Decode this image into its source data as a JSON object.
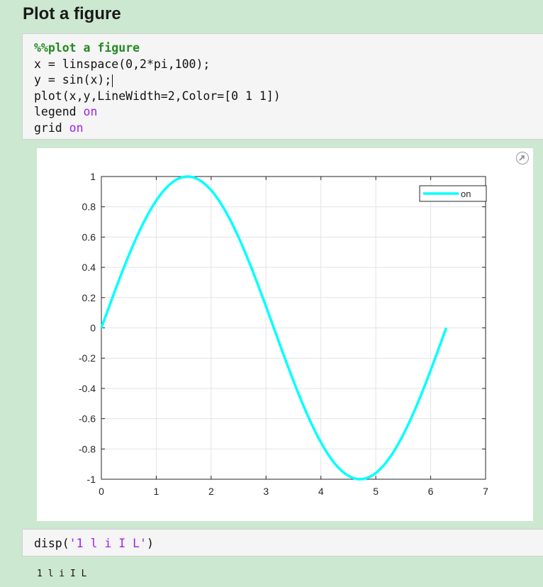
{
  "section": {
    "title": "Plot a figure"
  },
  "code_cell_1": {
    "comment_line": "%%plot a figure",
    "line_linspace": "x = linspace(0,2*pi,100);",
    "line_sin": "y = sin(x);",
    "line_plot": "plot(x,y,LineWidth=2,Color=[0 1 1])",
    "legend_cmd": "legend ",
    "legend_arg": "on",
    "grid_cmd": "grid ",
    "grid_arg": "on"
  },
  "figure": {
    "expand_icon": "expand-arrow-icon"
  },
  "chart_data": {
    "type": "line",
    "function": "sin(x)",
    "x_range": [
      0,
      6.2832
    ],
    "num_points": 100,
    "line_color": "#00ffff",
    "xlim": [
      0,
      7
    ],
    "ylim": [
      -1,
      1
    ],
    "xticks": [
      "0",
      "1",
      "2",
      "3",
      "4",
      "5",
      "6",
      "7"
    ],
    "yticks": [
      "1",
      "0.8",
      "0.6",
      "0.4",
      "0.2",
      "0",
      "-0.2",
      "-0.4",
      "-0.6",
      "-0.8",
      "-1"
    ],
    "grid": true,
    "legend": {
      "entries": [
        "on"
      ],
      "location": "top-right"
    },
    "series": [
      {
        "name": "on"
      }
    ]
  },
  "code_cell_2": {
    "func": "disp(",
    "string_literal": "'1 l i I L'",
    "close": ")"
  },
  "output": {
    "text": "1 l i I L"
  }
}
